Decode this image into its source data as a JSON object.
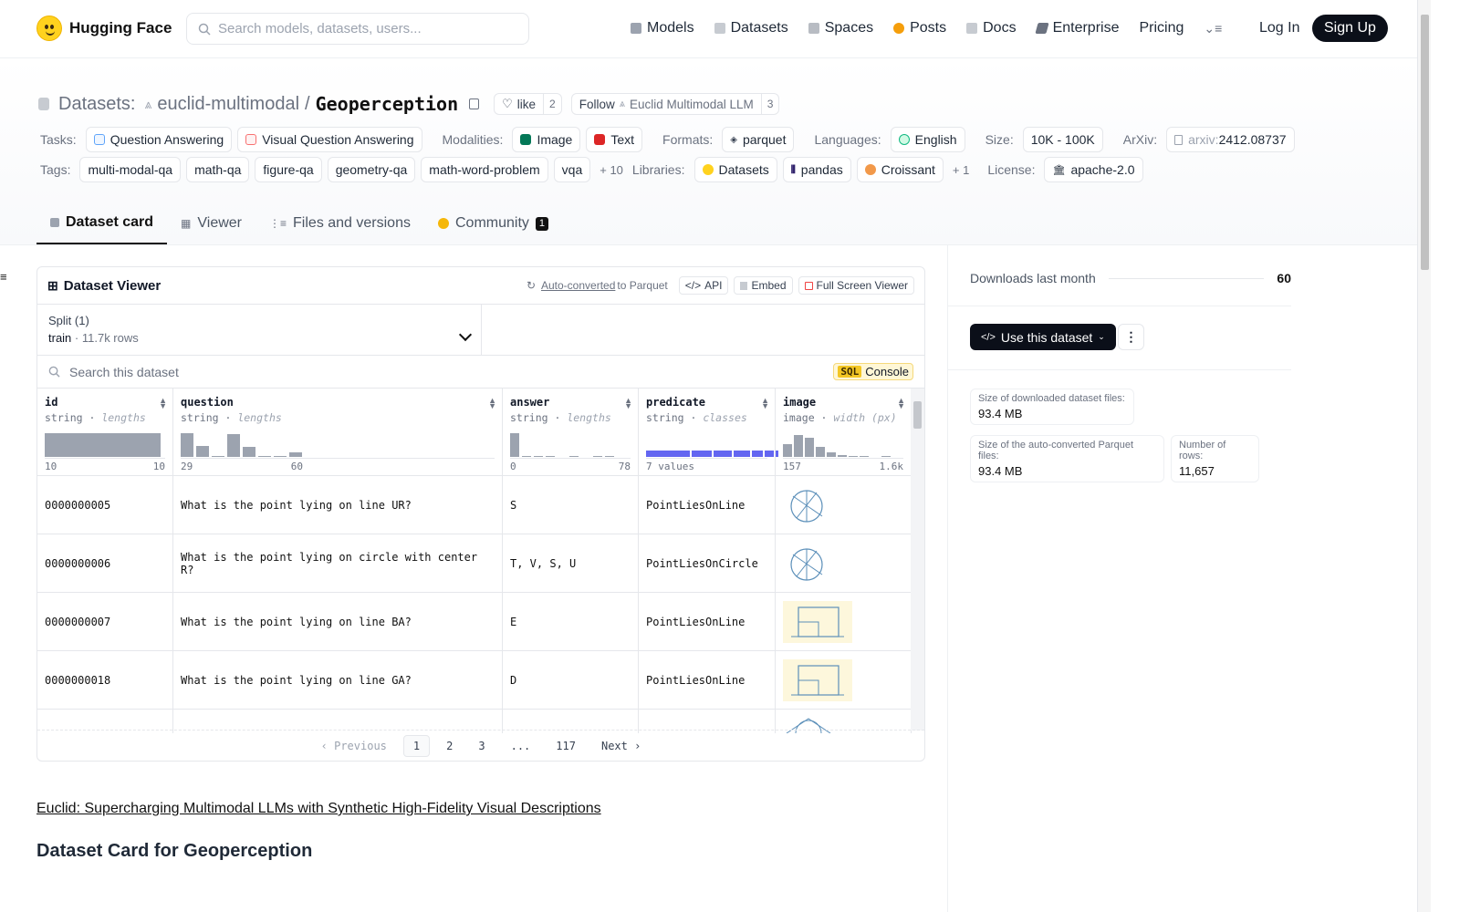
{
  "nav": {
    "brand": "Hugging Face",
    "search_placeholder": "Search models, datasets, users...",
    "links": [
      "Models",
      "Datasets",
      "Spaces",
      "Posts",
      "Docs",
      "Enterprise",
      "Pricing"
    ],
    "login": "Log In",
    "signup": "Sign Up"
  },
  "header": {
    "section": "Datasets:",
    "org": "euclid-multimodal",
    "slash": "/",
    "name": "Geoperception",
    "like_label": "like",
    "like_count": "2",
    "follow_label": "Follow",
    "follow_org": "Euclid Multimodal LLM",
    "follow_count": "3"
  },
  "meta": {
    "tasks_label": "Tasks:",
    "tasks": [
      "Question Answering",
      "Visual Question Answering"
    ],
    "modalities_label": "Modalities:",
    "modalities": [
      "Image",
      "Text"
    ],
    "formats_label": "Formats:",
    "formats": [
      "parquet"
    ],
    "languages_label": "Languages:",
    "languages": [
      "English"
    ],
    "size_label": "Size:",
    "size": "10K - 100K",
    "arxiv_label": "ArXiv:",
    "arxiv_prefix": "arxiv:",
    "arxiv_id": "2412.08737",
    "tags_label": "Tags:",
    "tags": [
      "multi-modal-qa",
      "math-qa",
      "figure-qa",
      "geometry-qa",
      "math-word-problem",
      "vqa"
    ],
    "tags_more": "+ 10",
    "libraries_label": "Libraries:",
    "libraries": [
      "Datasets",
      "pandas",
      "Croissant"
    ],
    "libraries_more": "+ 1",
    "license_label": "License:",
    "license": "apache-2.0"
  },
  "tabs": {
    "card": "Dataset card",
    "viewer": "Viewer",
    "files": "Files and versions",
    "community": "Community",
    "community_count": "1"
  },
  "viewer": {
    "title": "Dataset Viewer",
    "autoconv": "Auto-converted",
    "to_parquet": "to Parquet",
    "api": "API",
    "embed": "Embed",
    "fullscreen": "Full Screen Viewer",
    "split_label": "Split (1)",
    "split_name": "train",
    "split_rows": "11.7k rows",
    "search_placeholder": "Search this dataset",
    "sql_tag": "SQL",
    "sql_label": "Console",
    "columns": [
      {
        "name": "id",
        "type": "string",
        "stat": "lengths",
        "min": "10",
        "max": "10"
      },
      {
        "name": "question",
        "type": "string",
        "stat": "lengths",
        "min": "29",
        "max": "60"
      },
      {
        "name": "answer",
        "type": "string",
        "stat": "lengths",
        "min": "0",
        "max": "78"
      },
      {
        "name": "predicate",
        "type": "string",
        "stat": "classes",
        "min": "7 values",
        "max": ""
      },
      {
        "name": "image",
        "type": "image",
        "stat": "width (px)",
        "min": "157",
        "max": "1.6k"
      }
    ],
    "rows": [
      {
        "id": "0000000005",
        "question": "What is the point lying on line UR?",
        "answer": "S",
        "predicate": "PointLiesOnLine"
      },
      {
        "id": "0000000006",
        "question": "What is the point lying on circle with center R?",
        "answer": "T, V, S, U",
        "predicate": "PointLiesOnCircle"
      },
      {
        "id": "0000000007",
        "question": "What is the point lying on line BA?",
        "answer": "E",
        "predicate": "PointLiesOnLine"
      },
      {
        "id": "0000000018",
        "question": "What is the point lying on line GA?",
        "answer": "D",
        "predicate": "PointLiesOnLine"
      }
    ],
    "pager": {
      "prev": "Previous",
      "p1": "1",
      "p2": "2",
      "p3": "3",
      "ellipsis": "...",
      "last": "117",
      "next": "Next"
    }
  },
  "sidebar": {
    "downloads_label": "Downloads last month",
    "downloads": "60",
    "use_button": "Use this dataset",
    "dl_size_label": "Size of downloaded dataset files:",
    "dl_size": "93.4 MB",
    "pq_size_label": "Size of the auto-converted Parquet files:",
    "pq_size": "93.4 MB",
    "rows_label": "Number of rows:",
    "rows": "11,657"
  },
  "card": {
    "paper_link": "Euclid: Supercharging Multimodal LLMs with Synthetic High-Fidelity Visual Descriptions",
    "title": "Dataset Card for Geoperception"
  }
}
